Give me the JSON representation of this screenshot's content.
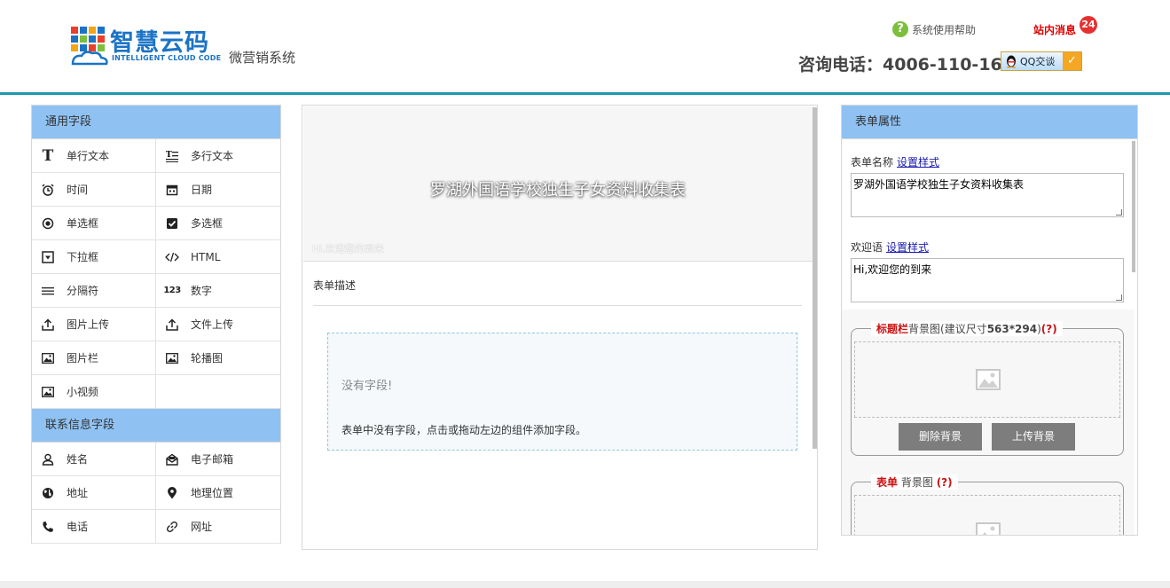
{
  "header": {
    "logo_cn": "智慧云码",
    "logo_en": "INTELLIGENT CLOUD CODE",
    "logo_sub": "微营销系统",
    "help_label": "系统使用帮助",
    "messages_label": "站内消息",
    "messages_count": "24",
    "phone": "咨询电话：4006-110-166",
    "qq_label": "QQ交谈"
  },
  "left": {
    "common_title": "通用字段",
    "common_items": [
      {
        "label": "单行文本",
        "icon": "text-icon"
      },
      {
        "label": "多行文本",
        "icon": "multiline-text-icon"
      },
      {
        "label": "时间",
        "icon": "clock-icon"
      },
      {
        "label": "日期",
        "icon": "calendar-icon"
      },
      {
        "label": "单选框",
        "icon": "radio-icon"
      },
      {
        "label": "多选框",
        "icon": "checkbox-icon"
      },
      {
        "label": "下拉框",
        "icon": "dropdown-icon"
      },
      {
        "label": "HTML",
        "icon": "code-icon"
      },
      {
        "label": "分隔符",
        "icon": "separator-icon"
      },
      {
        "label": "数字",
        "icon": "number-icon"
      },
      {
        "label": "图片上传",
        "icon": "upload-icon"
      },
      {
        "label": "文件上传",
        "icon": "upload-icon"
      },
      {
        "label": "图片栏",
        "icon": "image-icon"
      },
      {
        "label": "轮播图",
        "icon": "image-icon"
      },
      {
        "label": "小视频",
        "icon": "image-icon"
      }
    ],
    "contact_title": "联系信息字段",
    "contact_items": [
      {
        "label": "姓名",
        "icon": "user-icon"
      },
      {
        "label": "电子邮箱",
        "icon": "mail-icon"
      },
      {
        "label": "地址",
        "icon": "globe-icon"
      },
      {
        "label": "地理位置",
        "icon": "location-icon"
      },
      {
        "label": "电话",
        "icon": "phone-icon"
      },
      {
        "label": "网址",
        "icon": "link-icon"
      }
    ]
  },
  "middle": {
    "form_title": "罗湖外国语学校独生子女资料收集表",
    "welcome": "Hi,欢迎您的到来",
    "desc_label": "表单描述",
    "empty_title": "没有字段!",
    "empty_desc": "表单中没有字段，点击或拖动左边的组件添加字段。"
  },
  "right": {
    "title": "表单属性",
    "name_label": "表单名称",
    "style_link": "设置样式",
    "name_value": "罗湖外国语学校独生子女资料收集表",
    "welcome_label": "欢迎语",
    "welcome_value": "Hi,欢迎您的到来",
    "titlebar_bg_red": "标题栏",
    "titlebar_bg_rest": "背景图(建议尺寸",
    "titlebar_bg_size": "563*294",
    "titlebar_bg_end": ")",
    "help_mark": "(?)",
    "delete_bg": "删除背景",
    "upload_bg": "上传背景",
    "form_bg_red": "表单",
    "form_bg_rest": "背景图"
  },
  "colors": {
    "panel_header": "#8fc2f3",
    "header_line": "#1a9aa8",
    "brand_blue": "#1b73c6",
    "alert_red": "#e00000"
  }
}
